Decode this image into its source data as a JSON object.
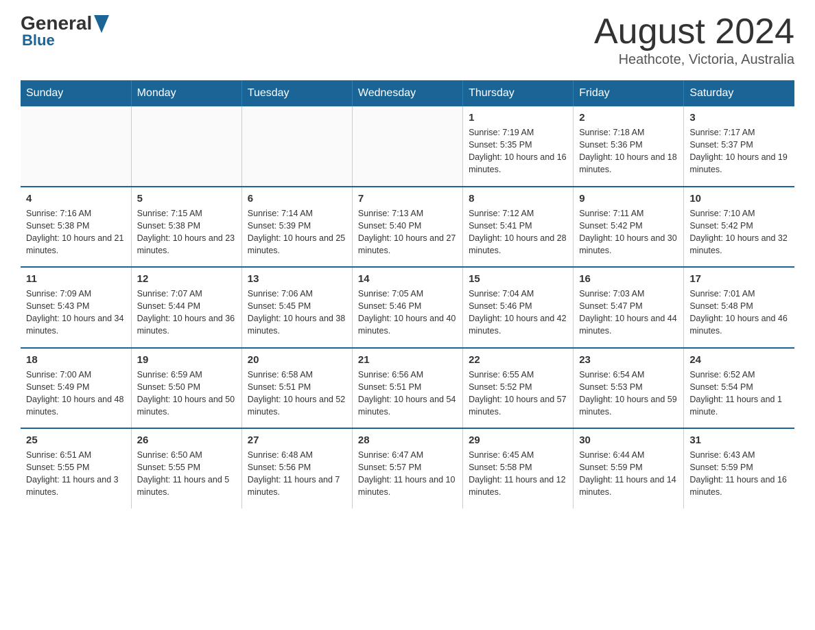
{
  "header": {
    "logo_general": "General",
    "logo_blue": "Blue",
    "month_title": "August 2024",
    "location": "Heathcote, Victoria, Australia"
  },
  "days_of_week": [
    "Sunday",
    "Monday",
    "Tuesday",
    "Wednesday",
    "Thursday",
    "Friday",
    "Saturday"
  ],
  "weeks": [
    {
      "days": [
        {
          "num": "",
          "info": ""
        },
        {
          "num": "",
          "info": ""
        },
        {
          "num": "",
          "info": ""
        },
        {
          "num": "",
          "info": ""
        },
        {
          "num": "1",
          "info": "Sunrise: 7:19 AM\nSunset: 5:35 PM\nDaylight: 10 hours and 16 minutes."
        },
        {
          "num": "2",
          "info": "Sunrise: 7:18 AM\nSunset: 5:36 PM\nDaylight: 10 hours and 18 minutes."
        },
        {
          "num": "3",
          "info": "Sunrise: 7:17 AM\nSunset: 5:37 PM\nDaylight: 10 hours and 19 minutes."
        }
      ]
    },
    {
      "days": [
        {
          "num": "4",
          "info": "Sunrise: 7:16 AM\nSunset: 5:38 PM\nDaylight: 10 hours and 21 minutes."
        },
        {
          "num": "5",
          "info": "Sunrise: 7:15 AM\nSunset: 5:38 PM\nDaylight: 10 hours and 23 minutes."
        },
        {
          "num": "6",
          "info": "Sunrise: 7:14 AM\nSunset: 5:39 PM\nDaylight: 10 hours and 25 minutes."
        },
        {
          "num": "7",
          "info": "Sunrise: 7:13 AM\nSunset: 5:40 PM\nDaylight: 10 hours and 27 minutes."
        },
        {
          "num": "8",
          "info": "Sunrise: 7:12 AM\nSunset: 5:41 PM\nDaylight: 10 hours and 28 minutes."
        },
        {
          "num": "9",
          "info": "Sunrise: 7:11 AM\nSunset: 5:42 PM\nDaylight: 10 hours and 30 minutes."
        },
        {
          "num": "10",
          "info": "Sunrise: 7:10 AM\nSunset: 5:42 PM\nDaylight: 10 hours and 32 minutes."
        }
      ]
    },
    {
      "days": [
        {
          "num": "11",
          "info": "Sunrise: 7:09 AM\nSunset: 5:43 PM\nDaylight: 10 hours and 34 minutes."
        },
        {
          "num": "12",
          "info": "Sunrise: 7:07 AM\nSunset: 5:44 PM\nDaylight: 10 hours and 36 minutes."
        },
        {
          "num": "13",
          "info": "Sunrise: 7:06 AM\nSunset: 5:45 PM\nDaylight: 10 hours and 38 minutes."
        },
        {
          "num": "14",
          "info": "Sunrise: 7:05 AM\nSunset: 5:46 PM\nDaylight: 10 hours and 40 minutes."
        },
        {
          "num": "15",
          "info": "Sunrise: 7:04 AM\nSunset: 5:46 PM\nDaylight: 10 hours and 42 minutes."
        },
        {
          "num": "16",
          "info": "Sunrise: 7:03 AM\nSunset: 5:47 PM\nDaylight: 10 hours and 44 minutes."
        },
        {
          "num": "17",
          "info": "Sunrise: 7:01 AM\nSunset: 5:48 PM\nDaylight: 10 hours and 46 minutes."
        }
      ]
    },
    {
      "days": [
        {
          "num": "18",
          "info": "Sunrise: 7:00 AM\nSunset: 5:49 PM\nDaylight: 10 hours and 48 minutes."
        },
        {
          "num": "19",
          "info": "Sunrise: 6:59 AM\nSunset: 5:50 PM\nDaylight: 10 hours and 50 minutes."
        },
        {
          "num": "20",
          "info": "Sunrise: 6:58 AM\nSunset: 5:51 PM\nDaylight: 10 hours and 52 minutes."
        },
        {
          "num": "21",
          "info": "Sunrise: 6:56 AM\nSunset: 5:51 PM\nDaylight: 10 hours and 54 minutes."
        },
        {
          "num": "22",
          "info": "Sunrise: 6:55 AM\nSunset: 5:52 PM\nDaylight: 10 hours and 57 minutes."
        },
        {
          "num": "23",
          "info": "Sunrise: 6:54 AM\nSunset: 5:53 PM\nDaylight: 10 hours and 59 minutes."
        },
        {
          "num": "24",
          "info": "Sunrise: 6:52 AM\nSunset: 5:54 PM\nDaylight: 11 hours and 1 minute."
        }
      ]
    },
    {
      "days": [
        {
          "num": "25",
          "info": "Sunrise: 6:51 AM\nSunset: 5:55 PM\nDaylight: 11 hours and 3 minutes."
        },
        {
          "num": "26",
          "info": "Sunrise: 6:50 AM\nSunset: 5:55 PM\nDaylight: 11 hours and 5 minutes."
        },
        {
          "num": "27",
          "info": "Sunrise: 6:48 AM\nSunset: 5:56 PM\nDaylight: 11 hours and 7 minutes."
        },
        {
          "num": "28",
          "info": "Sunrise: 6:47 AM\nSunset: 5:57 PM\nDaylight: 11 hours and 10 minutes."
        },
        {
          "num": "29",
          "info": "Sunrise: 6:45 AM\nSunset: 5:58 PM\nDaylight: 11 hours and 12 minutes."
        },
        {
          "num": "30",
          "info": "Sunrise: 6:44 AM\nSunset: 5:59 PM\nDaylight: 11 hours and 14 minutes."
        },
        {
          "num": "31",
          "info": "Sunrise: 6:43 AM\nSunset: 5:59 PM\nDaylight: 11 hours and 16 minutes."
        }
      ]
    }
  ]
}
